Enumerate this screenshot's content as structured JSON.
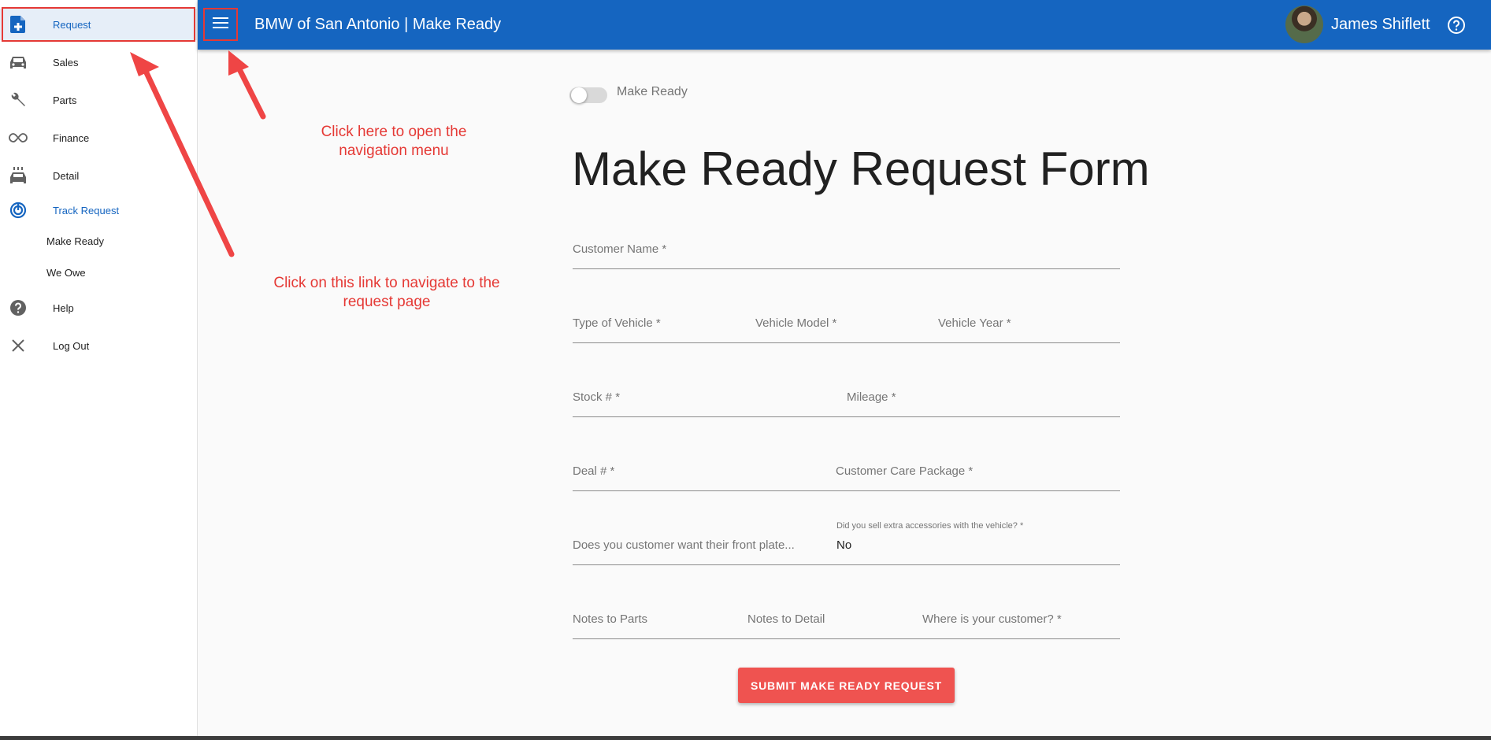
{
  "sidebar": {
    "items": [
      {
        "label": "Request",
        "icon": "note-add-icon"
      },
      {
        "label": "Sales",
        "icon": "car-icon"
      },
      {
        "label": "Parts",
        "icon": "wrench-icon"
      },
      {
        "label": "Finance",
        "icon": "infinity-icon"
      },
      {
        "label": "Detail",
        "icon": "car-wash-icon"
      },
      {
        "label": "Track Request",
        "icon": "track-changes-icon"
      }
    ],
    "sub_items": [
      {
        "label": "Make Ready"
      },
      {
        "label": "We Owe"
      }
    ],
    "bottom_items": [
      {
        "label": "Help",
        "icon": "help-circle-icon"
      },
      {
        "label": "Log Out",
        "icon": "close-icon"
      }
    ]
  },
  "appbar": {
    "title": "BMW of San Antonio | Make Ready",
    "user_name": "James Shiflett",
    "menu_icon": "hamburger-menu-icon",
    "help_icon": "help-outline-icon"
  },
  "form": {
    "toggle_label": "Make Ready",
    "toggle_on": false,
    "title": "Make Ready Request Form",
    "customer_name": "Customer Name *",
    "type_of_vehicle": "Type of Vehicle *",
    "vehicle_model": "Vehicle Model *",
    "vehicle_year": "Vehicle Year *",
    "stock": "Stock # *",
    "mileage": "Mileage *",
    "deal": "Deal # *",
    "customer_care_package": "Customer Care Package *",
    "front_plate": "Does you customer want their front plate...",
    "extra_accessories_label": "Did you sell extra accessories with the vehicle? *",
    "extra_accessories_value": "No",
    "notes_parts": "Notes to Parts",
    "notes_detail": "Notes to Detail",
    "customer_location": "Where is your customer? *",
    "submit": "SUBMIT MAKE READY REQUEST"
  },
  "annotations": {
    "menu_line1": "Click here to open the",
    "menu_line2": "navigation menu",
    "request_line1": "Click on this link to navigate to the",
    "request_line2": "request page"
  },
  "colors": {
    "appbar": "#1565c0",
    "active_link": "#1565c0",
    "submit": "#ef5350",
    "annotation": "#e53935"
  }
}
